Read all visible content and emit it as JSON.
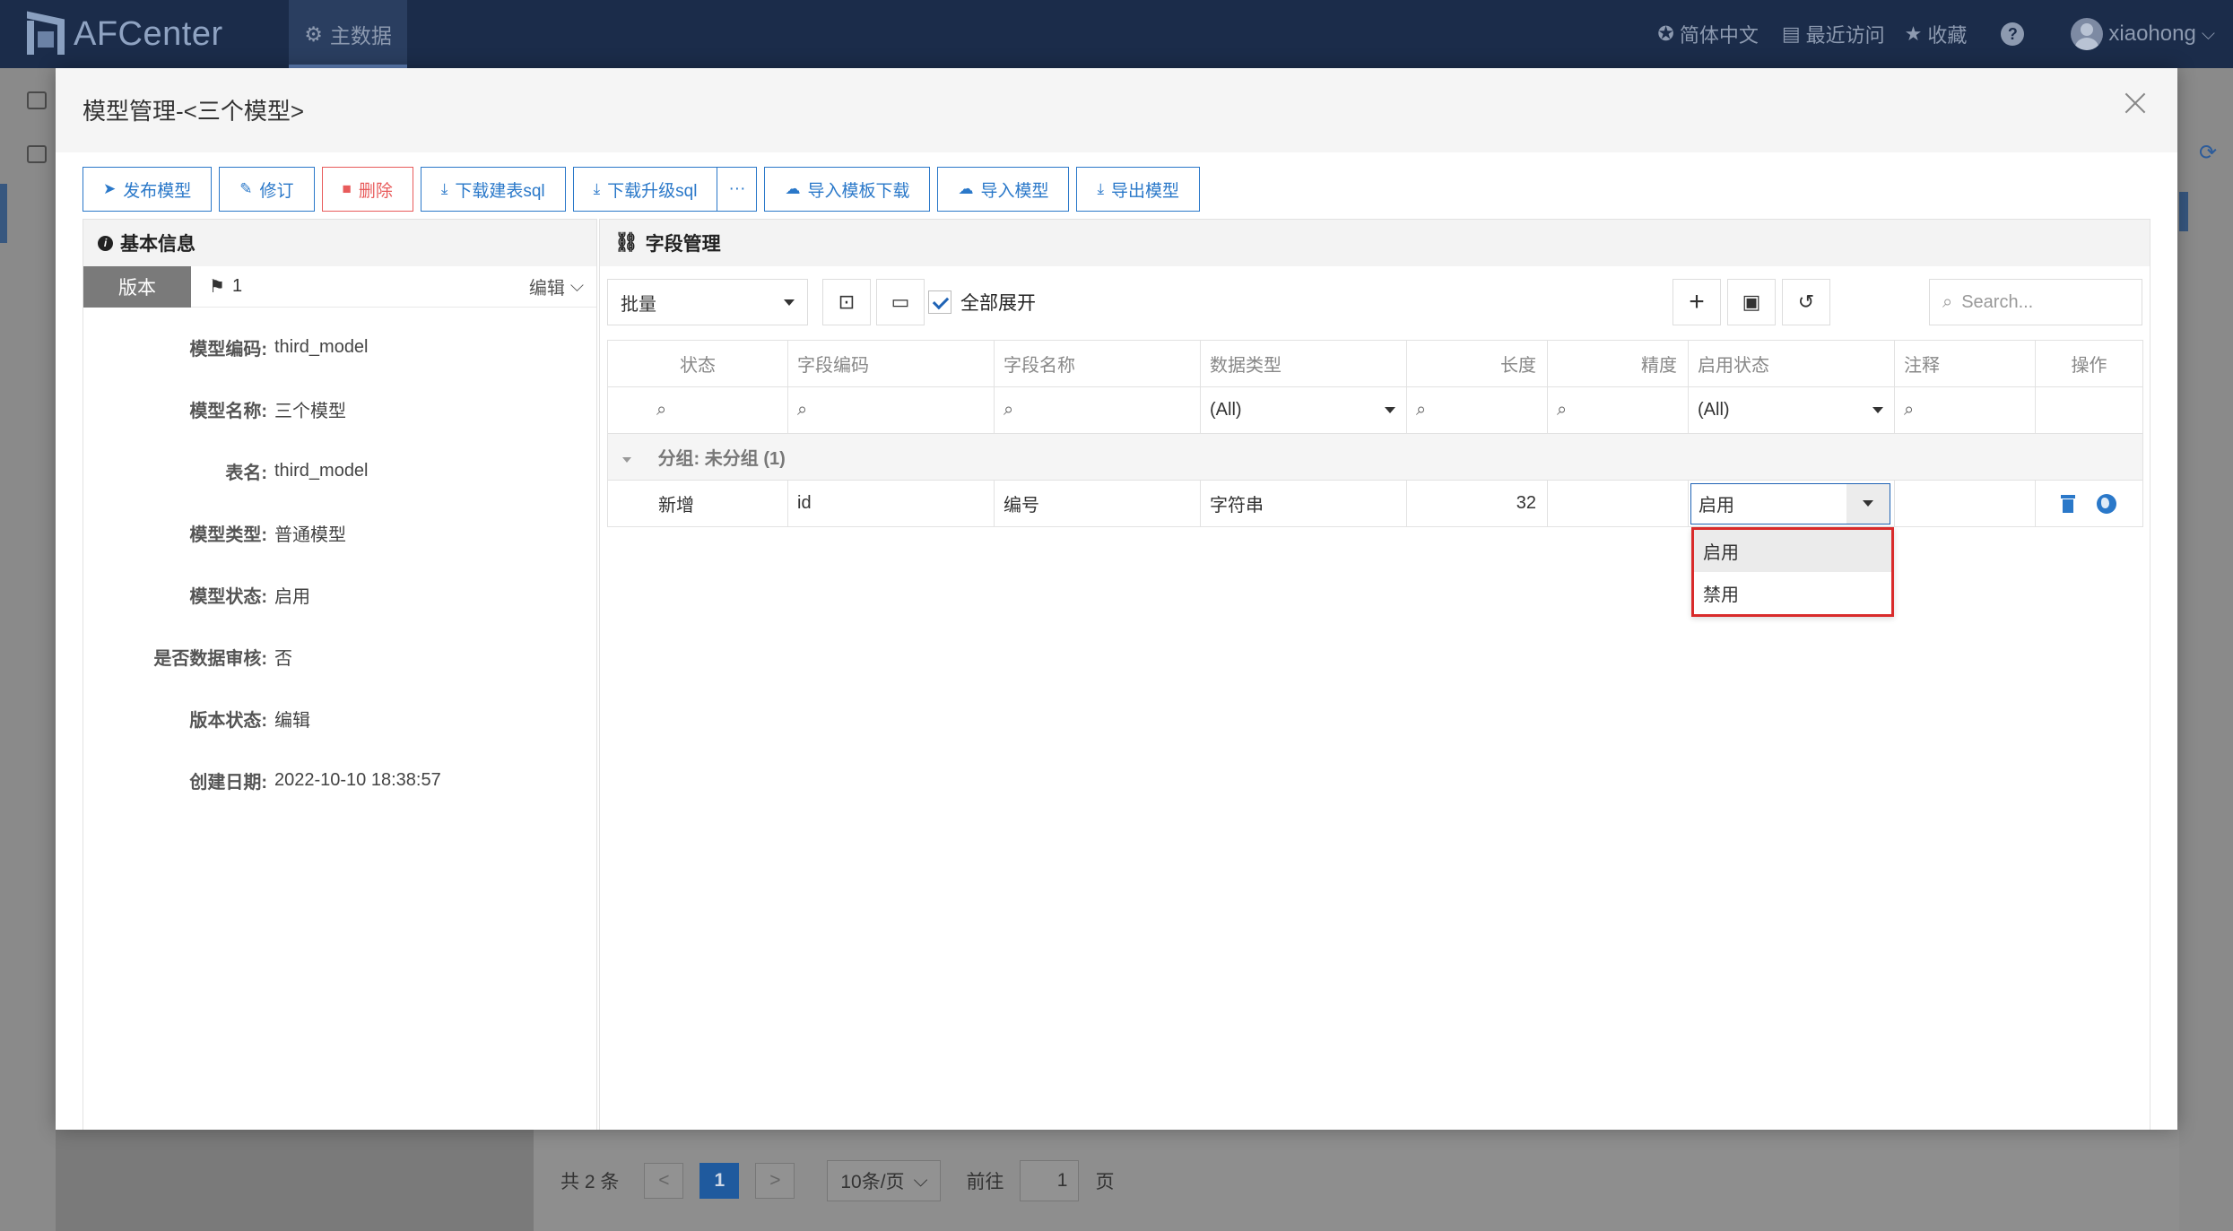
{
  "app": {
    "name": "AFCenter",
    "nav": "主数据",
    "lang": "简体中文",
    "recent": "最近访问",
    "favorites": "收藏",
    "help": "?",
    "user": "xiaohong"
  },
  "pager": {
    "total": "共 2 条",
    "prev": "<",
    "current": "1",
    "next": ">",
    "size": "10条/页",
    "goto": "前往",
    "goto_value": "1",
    "page_unit": "页"
  },
  "modal": {
    "title": "模型管理-<三个模型>",
    "toolbar": [
      {
        "label": "发布模型",
        "icon": "send-icon"
      },
      {
        "label": "修订",
        "icon": "edit-icon"
      },
      {
        "label": "删除",
        "icon": "trash-icon"
      },
      {
        "label": "下载建表sql",
        "icon": "download-icon"
      },
      {
        "label": "下载升级sql",
        "icon": "download-icon"
      },
      {
        "label": "···",
        "icon": "more-icon"
      },
      {
        "label": "导入模板下载",
        "icon": "cloud-download-icon"
      },
      {
        "label": "导入模型",
        "icon": "cloud-upload-icon"
      },
      {
        "label": "导出模型",
        "icon": "download-icon"
      }
    ],
    "basic": {
      "heading": "基本信息",
      "version_tab": "版本",
      "version_number": "1",
      "edit_label": "编辑",
      "fields": [
        {
          "label": "模型编码:",
          "value": "third_model"
        },
        {
          "label": "模型名称:",
          "value": "三个模型"
        },
        {
          "label": "表名:",
          "value": "third_model"
        },
        {
          "label": "模型类型:",
          "value": "普通模型"
        },
        {
          "label": "模型状态:",
          "value": "启用"
        },
        {
          "label": "是否数据审核:",
          "value": "否"
        },
        {
          "label": "版本状态:",
          "value": "编辑"
        },
        {
          "label": "创建日期:",
          "value": "2022-10-10 18:38:57"
        }
      ]
    },
    "fields_panel": {
      "heading": "字段管理",
      "batch": "批量",
      "expand_all": "全部展开",
      "search_placeholder": "Search...",
      "columns": [
        "状态",
        "字段编码",
        "字段名称",
        "数据类型",
        "长度",
        "精度",
        "启用状态",
        "注释",
        "操作"
      ],
      "filter_all": "(All)",
      "group_label": "分组: 未分组 (1)",
      "rows": [
        {
          "status": "新增",
          "code": "id",
          "name": "编号",
          "type": "字符串",
          "length": "32",
          "precision": "",
          "enabled": "启用",
          "comment": ""
        }
      ],
      "dropdown_options": [
        "启用",
        "禁用"
      ]
    }
  }
}
